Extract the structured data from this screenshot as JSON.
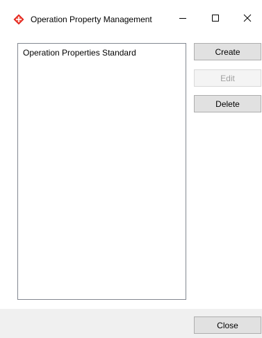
{
  "window": {
    "title": "Operation Property Management",
    "app_icon": "red-diamond-icon",
    "accent_color": "#e0201b"
  },
  "titlebar_buttons": {
    "minimize_icon": "minimize-icon",
    "maximize_icon": "maximize-icon",
    "close_icon": "close-icon"
  },
  "list": {
    "items": [
      "Operation Properties Standard"
    ]
  },
  "buttons": {
    "create": "Create",
    "edit": "Edit",
    "edit_enabled": false,
    "delete": "Delete",
    "close": "Close"
  }
}
